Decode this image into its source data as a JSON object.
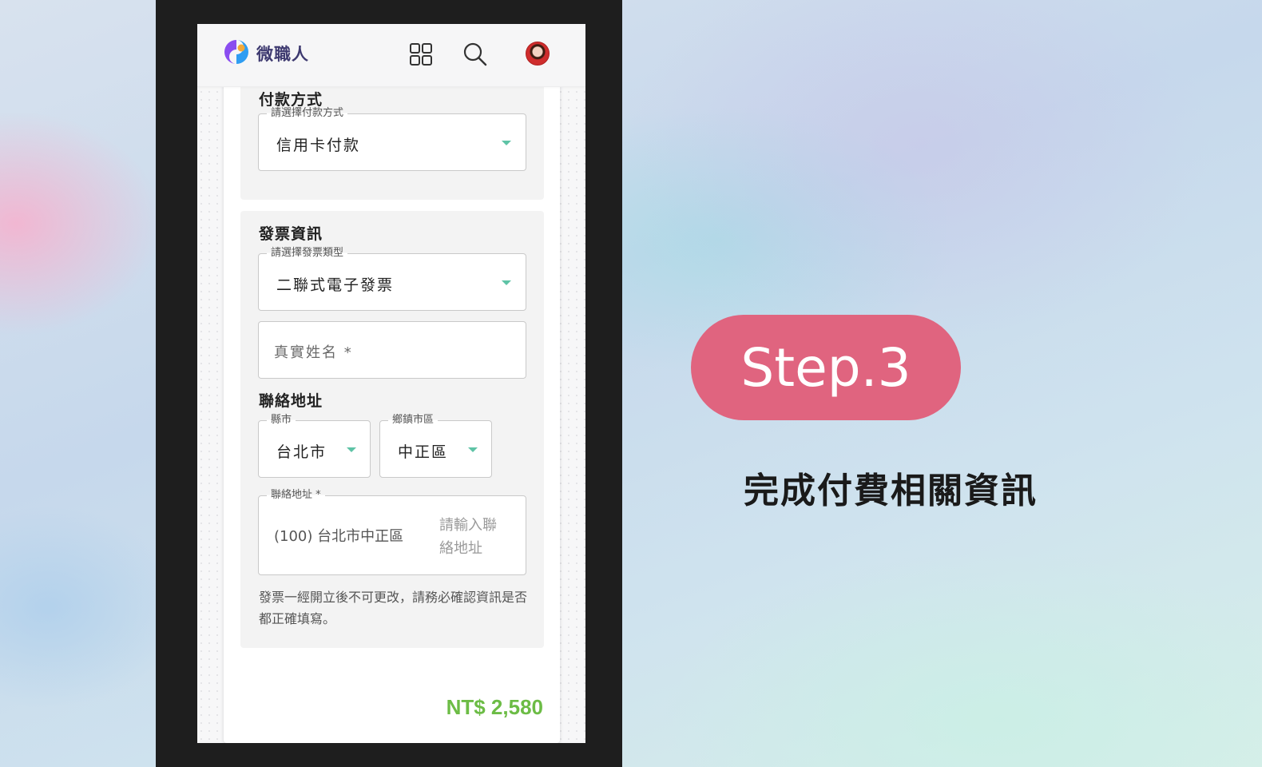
{
  "app": {
    "brand": "微職人"
  },
  "payment": {
    "title": "付款方式",
    "method_legend": "請選擇付款方式",
    "method_value": "信用卡付款"
  },
  "invoice": {
    "title": "發票資訊",
    "type_legend": "請選擇發票類型",
    "type_value": "二聯式電子發票",
    "name_placeholder": "真實姓名 *",
    "address_title": "聯絡地址",
    "county_legend": "縣市",
    "county_value": "台北市",
    "district_legend": "鄉鎮市區",
    "district_value": "中正區",
    "address_legend": "聯絡地址 *",
    "address_prefix": "(100) 台北市中正區",
    "address_placeholder_line1": "請輸入聯",
    "address_placeholder_line2": "絡地址",
    "note": "發票一經開立後不可更改，請務必確認資訊是否都正確填寫。"
  },
  "order": {
    "price": "NT$ 2,580"
  },
  "step": {
    "label": "Step.3",
    "caption": "完成付費相關資訊"
  },
  "colors": {
    "accent_pink": "#e0647f",
    "price_green": "#6cbc45",
    "caret_teal": "#5ec3a6",
    "brand_text": "#3e3a70"
  },
  "icons": [
    "logo-icon",
    "apps-grid-icon",
    "search-icon",
    "avatar",
    "dropdown-caret-icon"
  ]
}
